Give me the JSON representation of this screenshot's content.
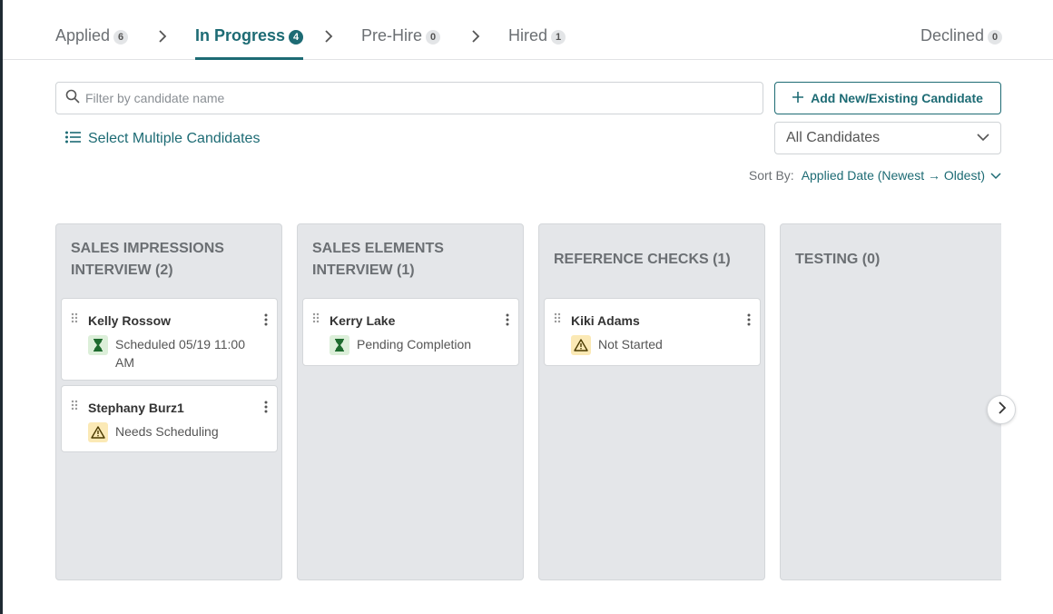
{
  "tabs": [
    {
      "label": "Applied",
      "count": "6"
    },
    {
      "label": "In Progress",
      "count": "4"
    },
    {
      "label": "Pre-Hire",
      "count": "0"
    },
    {
      "label": "Hired",
      "count": "1"
    },
    {
      "label": "Declined",
      "count": "0"
    }
  ],
  "search": {
    "placeholder": "Filter by candidate name"
  },
  "add_button": {
    "label": "Add New/Existing Candidate"
  },
  "select_multiple": {
    "label": "Select Multiple Candidates"
  },
  "filter_dropdown": {
    "value": "All Candidates"
  },
  "sort": {
    "label": "Sort By:",
    "value": "Applied Date (Newest → Oldest)"
  },
  "columns": [
    {
      "title": "SALES IMPRESSIONS INTERVIEW (2)",
      "cards": [
        {
          "name": "Kelly Rossow",
          "status": "Scheduled 05/19 11:00 AM",
          "icon": "hourglass-icon"
        },
        {
          "name": "Stephany Burz1",
          "status": "Needs Scheduling",
          "icon": "warning-icon"
        }
      ]
    },
    {
      "title": "SALES ELEMENTS INTERVIEW (1)",
      "cards": [
        {
          "name": "Kerry Lake",
          "status": "Pending Completion",
          "icon": "hourglass-icon"
        }
      ]
    },
    {
      "title": "REFERENCE CHECKS (1)",
      "cards": [
        {
          "name": "Kiki Adams",
          "status": "Not Started",
          "icon": "warning-icon"
        }
      ]
    },
    {
      "title": "TESTING (0)",
      "cards": []
    }
  ],
  "colors": {
    "accent": "#1d6b74",
    "column_bg": "#e4e6e9",
    "warning_bg": "#fbe9b5",
    "pending_bg": "#dcefd9"
  }
}
